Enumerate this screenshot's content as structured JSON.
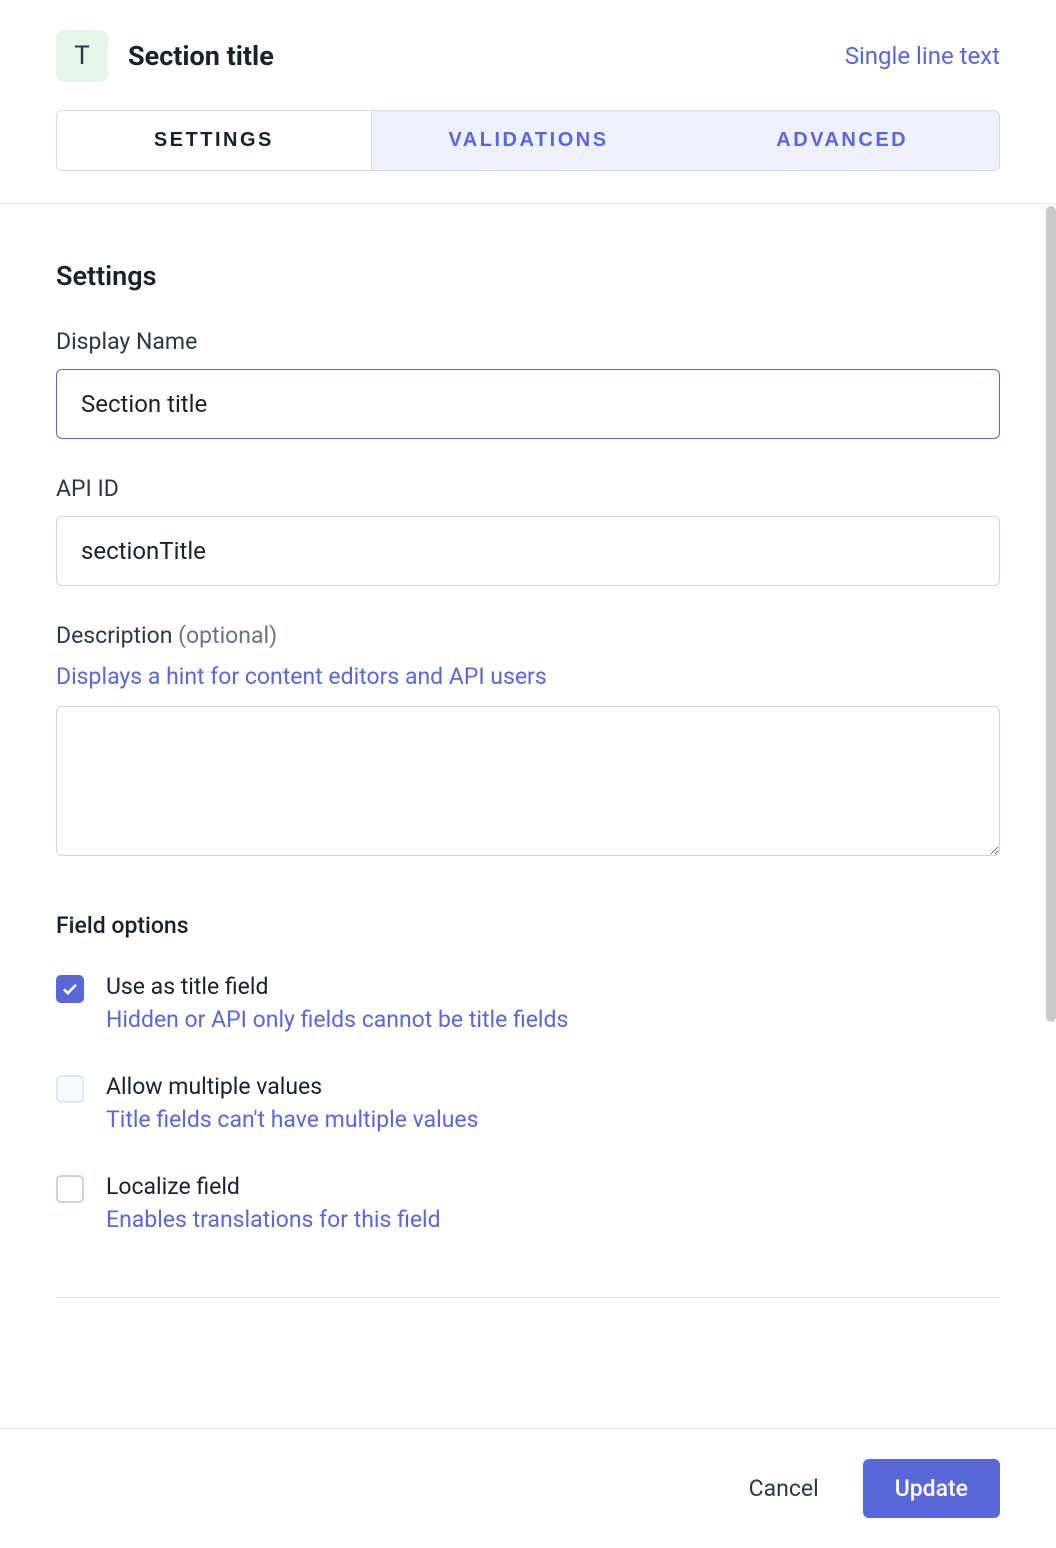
{
  "header": {
    "badge_letter": "T",
    "title": "Section title",
    "field_type": "Single line text"
  },
  "tabs": [
    {
      "label": "SETTINGS",
      "active": true
    },
    {
      "label": "VALIDATIONS",
      "active": false
    },
    {
      "label": "ADVANCED",
      "active": false
    }
  ],
  "settings": {
    "heading": "Settings",
    "display_name": {
      "label": "Display Name",
      "value": "Section title"
    },
    "api_id": {
      "label": "API ID",
      "value": "sectionTitle"
    },
    "description": {
      "label": "Description",
      "optional_text": "(optional)",
      "hint": "Displays a hint for content editors and API users",
      "value": ""
    },
    "field_options": {
      "heading": "Field options",
      "options": [
        {
          "label": "Use as title field",
          "desc": "Hidden or API only fields cannot be title fields",
          "checked": true,
          "disabled": false
        },
        {
          "label": "Allow multiple values",
          "desc": "Title fields can't have multiple values",
          "checked": false,
          "disabled": true
        },
        {
          "label": "Localize field",
          "desc": "Enables translations for this field",
          "checked": false,
          "disabled": false
        }
      ]
    }
  },
  "footer": {
    "cancel": "Cancel",
    "update": "Update"
  }
}
